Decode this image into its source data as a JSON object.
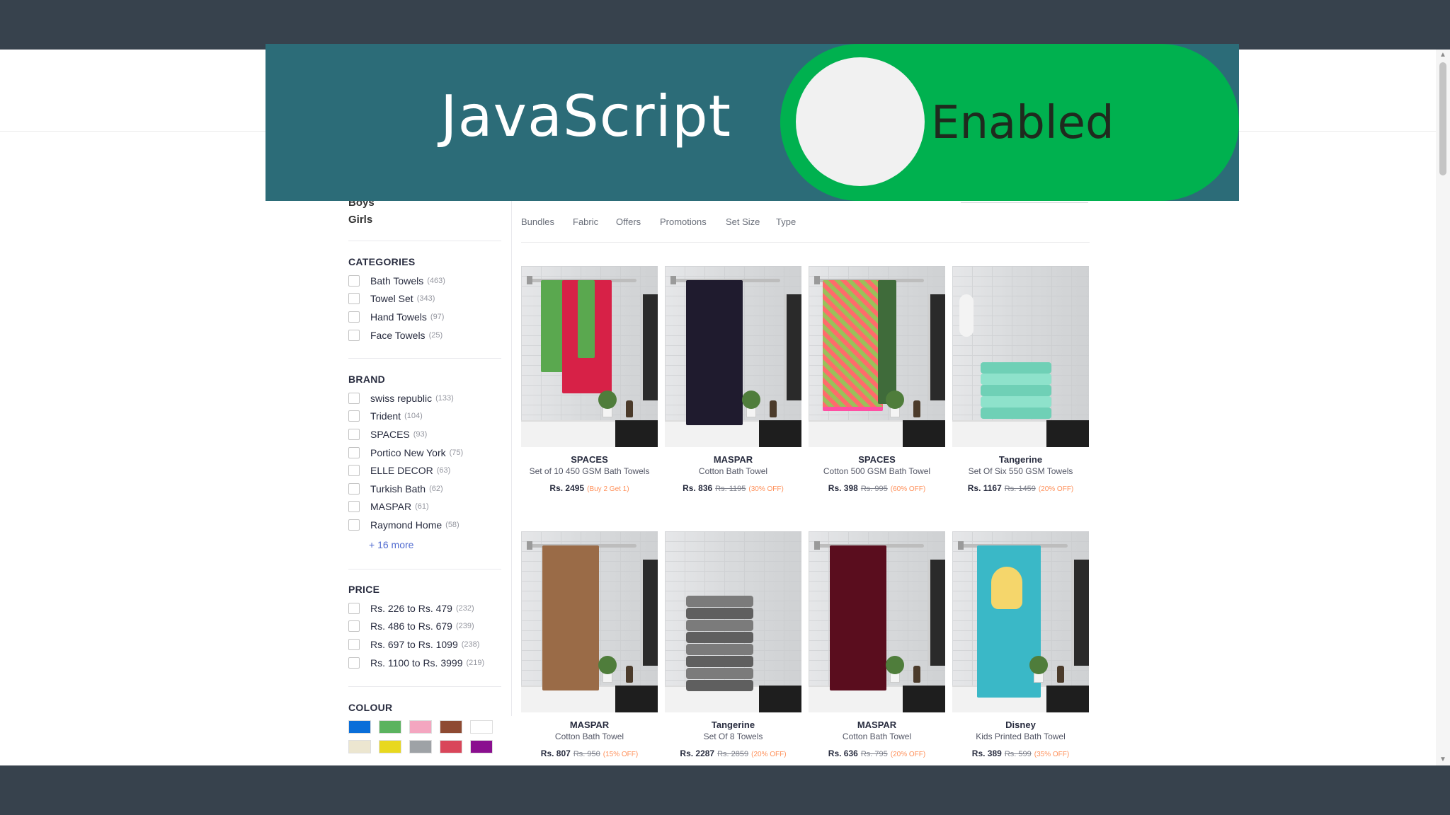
{
  "overlay": {
    "title": "JavaScript",
    "toggle_label": "Enabled",
    "toggle_on": true,
    "accent_color": "#00b14f",
    "banner_color": "#2c6c78"
  },
  "gender": [
    "Boys",
    "Girls"
  ],
  "filters": {
    "categories": {
      "title": "CATEGORIES",
      "options": [
        {
          "label": "Bath Towels",
          "count": "(463)"
        },
        {
          "label": "Towel Set",
          "count": "(343)"
        },
        {
          "label": "Hand Towels",
          "count": "(97)"
        },
        {
          "label": "Face Towels",
          "count": "(25)"
        }
      ]
    },
    "brand": {
      "title": "BRAND",
      "options": [
        {
          "label": "swiss republic",
          "count": "(133)"
        },
        {
          "label": "Trident",
          "count": "(104)"
        },
        {
          "label": "SPACES",
          "count": "(93)"
        },
        {
          "label": "Portico New York",
          "count": "(75)"
        },
        {
          "label": "ELLE DECOR",
          "count": "(63)"
        },
        {
          "label": "Turkish Bath",
          "count": "(62)"
        },
        {
          "label": "MASPAR",
          "count": "(61)"
        },
        {
          "label": "Raymond Home",
          "count": "(58)"
        }
      ],
      "more": "+ 16 more"
    },
    "price": {
      "title": "PRICE",
      "options": [
        {
          "label": "Rs. 226 to Rs. 479",
          "count": "(232)"
        },
        {
          "label": "Rs. 486 to Rs. 679",
          "count": "(239)"
        },
        {
          "label": "Rs. 697 to Rs. 1099",
          "count": "(238)"
        },
        {
          "label": "Rs. 1100 to Rs. 3999",
          "count": "(219)"
        }
      ]
    },
    "colour": {
      "title": "COLOUR",
      "swatches": [
        "#0a6ed9",
        "#5bb35f",
        "#f4a6c0",
        "#8e4a32",
        "#ffffff",
        "#ece6d0",
        "#e8d81f",
        "#9ea2a6",
        "#d9465a",
        "#8a0f8f"
      ]
    }
  },
  "filter_tabs": [
    "Bundles",
    "Fabric",
    "Offers",
    "Promotions",
    "Set Size",
    "Type"
  ],
  "products": [
    {
      "brand": "SPACES",
      "name": "Set of 10 450 GSM Bath Towels",
      "price": "Rs. 2495",
      "mrp": "",
      "discount": "(Buy 2 Get 1)"
    },
    {
      "brand": "MASPAR",
      "name": "Cotton Bath Towel",
      "price": "Rs. 836",
      "mrp": "Rs. 1195",
      "discount": "(30% OFF)"
    },
    {
      "brand": "SPACES",
      "name": "Cotton 500 GSM Bath Towel",
      "price": "Rs. 398",
      "mrp": "Rs. 995",
      "discount": "(60% OFF)"
    },
    {
      "brand": "Tangerine",
      "name": "Set Of Six 550 GSM Towels",
      "price": "Rs. 1167",
      "mrp": "Rs. 1459",
      "discount": "(20% OFF)"
    },
    {
      "brand": "MASPAR",
      "name": "Cotton Bath Towel",
      "price": "Rs. 807",
      "mrp": "Rs. 950",
      "discount": "(15% OFF)"
    },
    {
      "brand": "Tangerine",
      "name": "Set Of 8 Towels",
      "price": "Rs. 2287",
      "mrp": "Rs. 2859",
      "discount": "(20% OFF)"
    },
    {
      "brand": "MASPAR",
      "name": "Cotton Bath Towel",
      "price": "Rs. 636",
      "mrp": "Rs. 795",
      "discount": "(20% OFF)"
    },
    {
      "brand": "Disney",
      "name": "Kids Printed Bath Towel",
      "price": "Rs. 389",
      "mrp": "Rs. 599",
      "discount": "(35% OFF)"
    }
  ]
}
